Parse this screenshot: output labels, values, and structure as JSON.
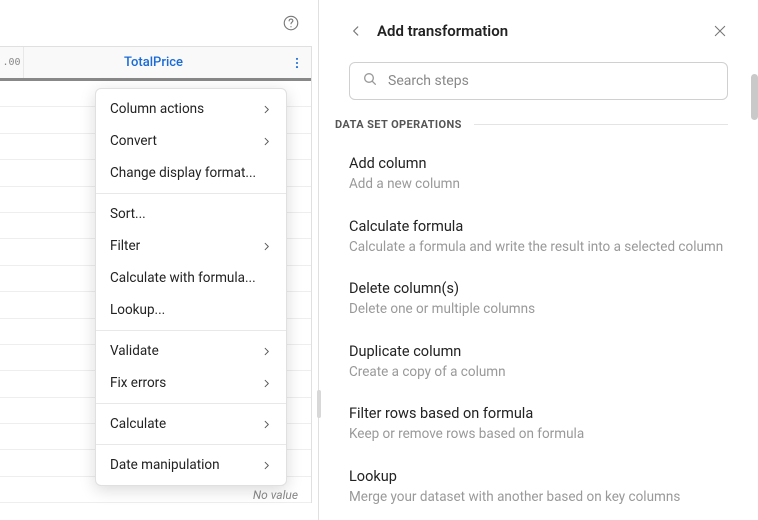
{
  "left": {
    "col_type_code": ".00",
    "col_name": "TotalPrice",
    "no_value_label": "No value"
  },
  "context_menu": {
    "groups": [
      [
        {
          "label": "Column actions",
          "submenu": true
        },
        {
          "label": "Convert",
          "submenu": true
        },
        {
          "label": "Change display format...",
          "submenu": false
        }
      ],
      [
        {
          "label": "Sort...",
          "submenu": false
        },
        {
          "label": "Filter",
          "submenu": true
        },
        {
          "label": "Calculate with formula...",
          "submenu": false
        },
        {
          "label": "Lookup...",
          "submenu": false
        }
      ],
      [
        {
          "label": "Validate",
          "submenu": true
        },
        {
          "label": "Fix errors",
          "submenu": true
        }
      ],
      [
        {
          "label": "Calculate",
          "submenu": true
        }
      ],
      [
        {
          "label": "Date manipulation",
          "submenu": true
        }
      ]
    ]
  },
  "panel": {
    "title": "Add transformation",
    "search_placeholder": "Search steps",
    "section_label": "DATA SET OPERATIONS",
    "items": [
      {
        "title": "Add column",
        "desc": "Add a new column"
      },
      {
        "title": "Calculate formula",
        "desc": "Calculate a formula and write the result into a selected column"
      },
      {
        "title": "Delete column(s)",
        "desc": "Delete one or multiple columns"
      },
      {
        "title": "Duplicate column",
        "desc": "Create a copy of a column"
      },
      {
        "title": "Filter rows based on formula",
        "desc": "Keep or remove rows based on formula"
      },
      {
        "title": "Lookup",
        "desc": "Merge your dataset with another based on key columns"
      }
    ]
  }
}
